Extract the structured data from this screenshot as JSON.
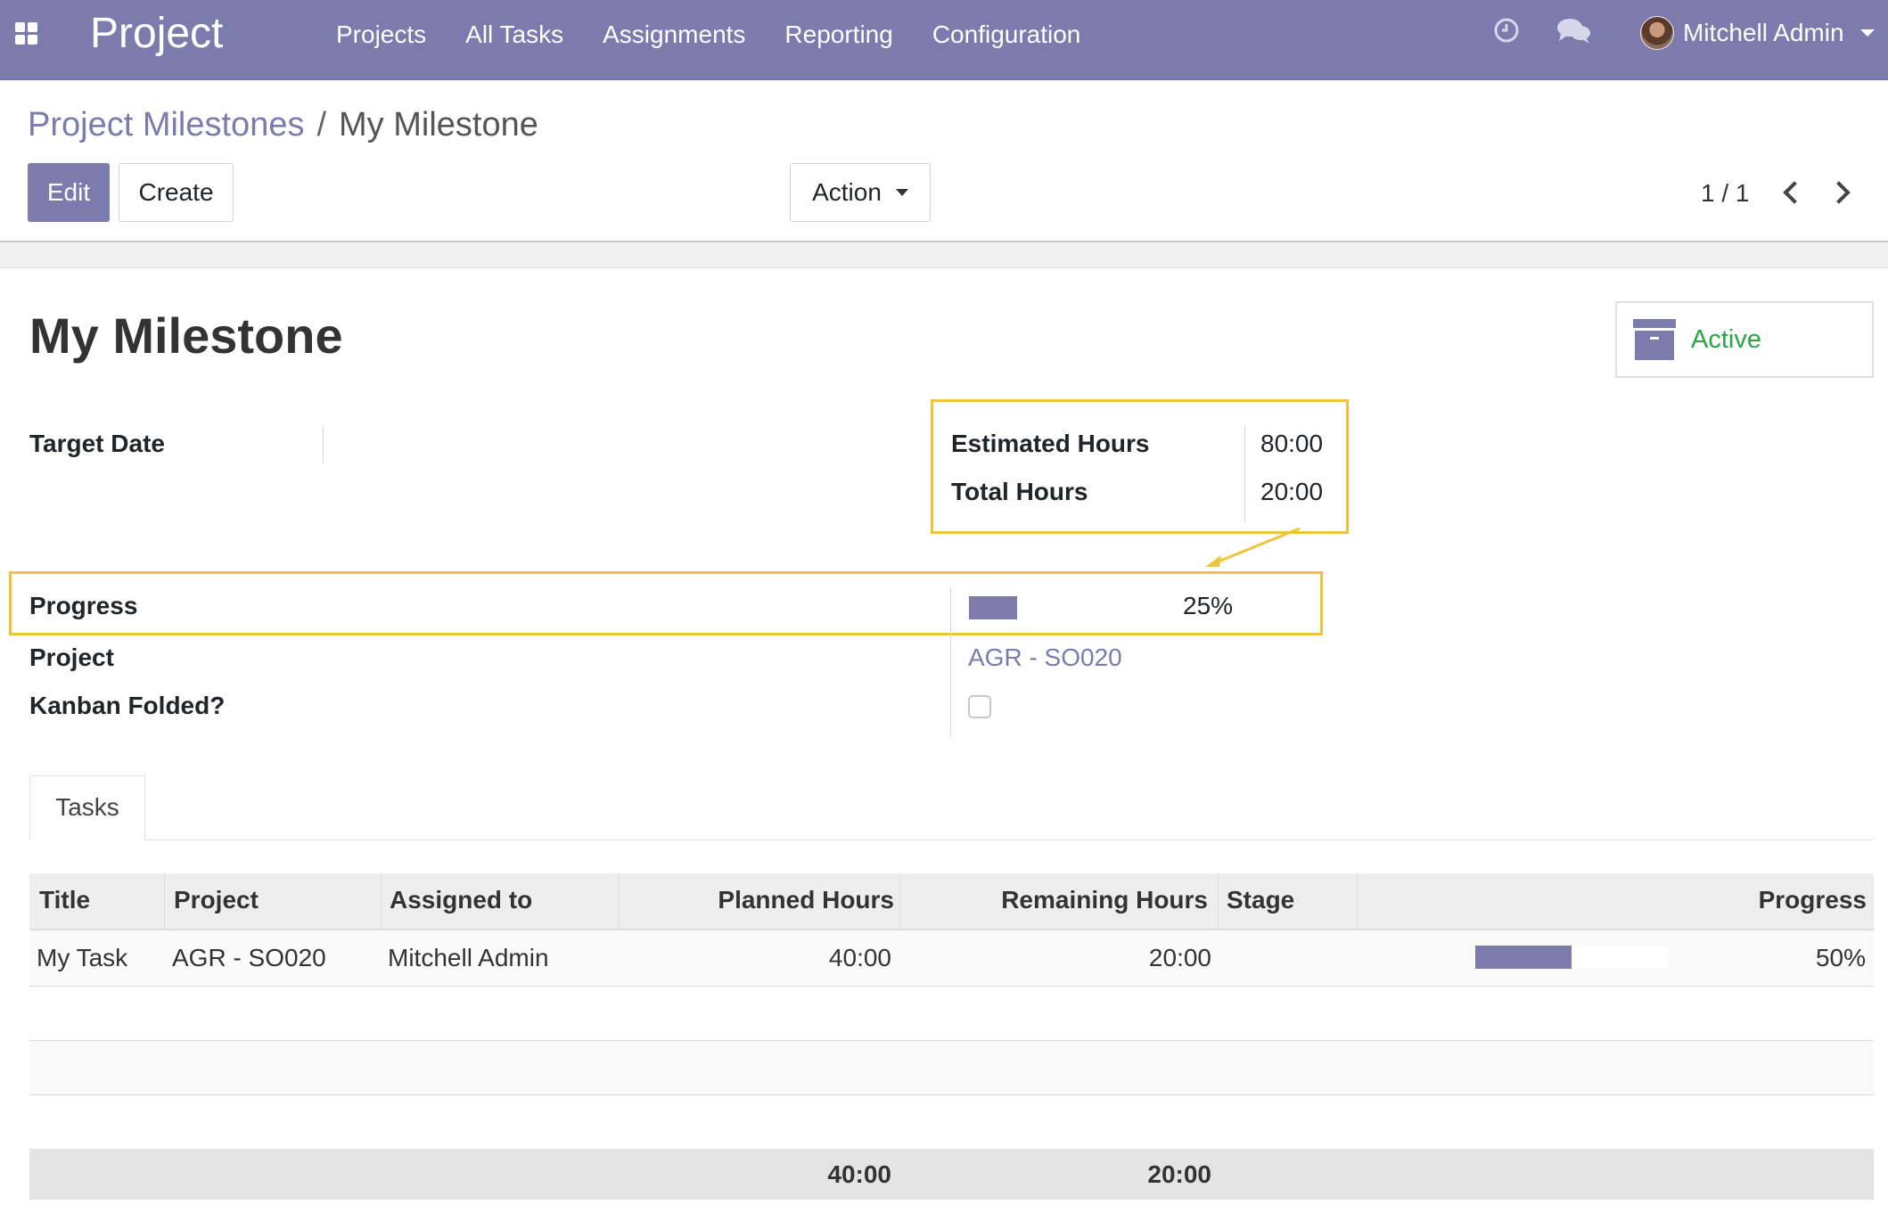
{
  "navbar": {
    "app_name": "Project",
    "menu": [
      "Projects",
      "All Tasks",
      "Assignments",
      "Reporting",
      "Configuration"
    ],
    "icons": [
      "apps-grid-icon",
      "clock-icon",
      "chat-icon"
    ],
    "user_name": "Mitchell Admin"
  },
  "breadcrumb": {
    "parent": "Project Milestones",
    "separator": "/",
    "current": "My Milestone"
  },
  "toolbar": {
    "edit_label": "Edit",
    "create_label": "Create",
    "action_label": "Action",
    "pager": "1 / 1"
  },
  "record": {
    "title": "My Milestone",
    "status_label": "Active",
    "fields": {
      "target_date_label": "Target Date",
      "target_date_value": "",
      "estimated_hours_label": "Estimated Hours",
      "estimated_hours_value": "80:00",
      "total_hours_label": "Total Hours",
      "total_hours_value": "20:00",
      "progress_label": "Progress",
      "progress_value": "25%",
      "progress_fraction": 0.25,
      "project_label": "Project",
      "project_value": "AGR - SO020",
      "kanban_folded_label": "Kanban Folded?",
      "kanban_folded_value": false
    }
  },
  "tabs": [
    "Tasks"
  ],
  "tasks_table": {
    "headers": [
      "Title",
      "Project",
      "Assigned to",
      "Planned Hours",
      "Remaining Hours",
      "Stage",
      "Progress"
    ],
    "rows": [
      {
        "title": "My Task",
        "project": "AGR - SO020",
        "assigned_to": "Mitchell Admin",
        "planned_hours": "40:00",
        "remaining_hours": "20:00",
        "stage": "",
        "progress": "50%",
        "progress_fraction": 0.5
      }
    ],
    "totals": {
      "planned_hours": "40:00",
      "remaining_hours": "20:00"
    }
  },
  "colors": {
    "brand": "#7c7bad",
    "active_green": "#28a745",
    "highlight": "#f0c23e"
  }
}
